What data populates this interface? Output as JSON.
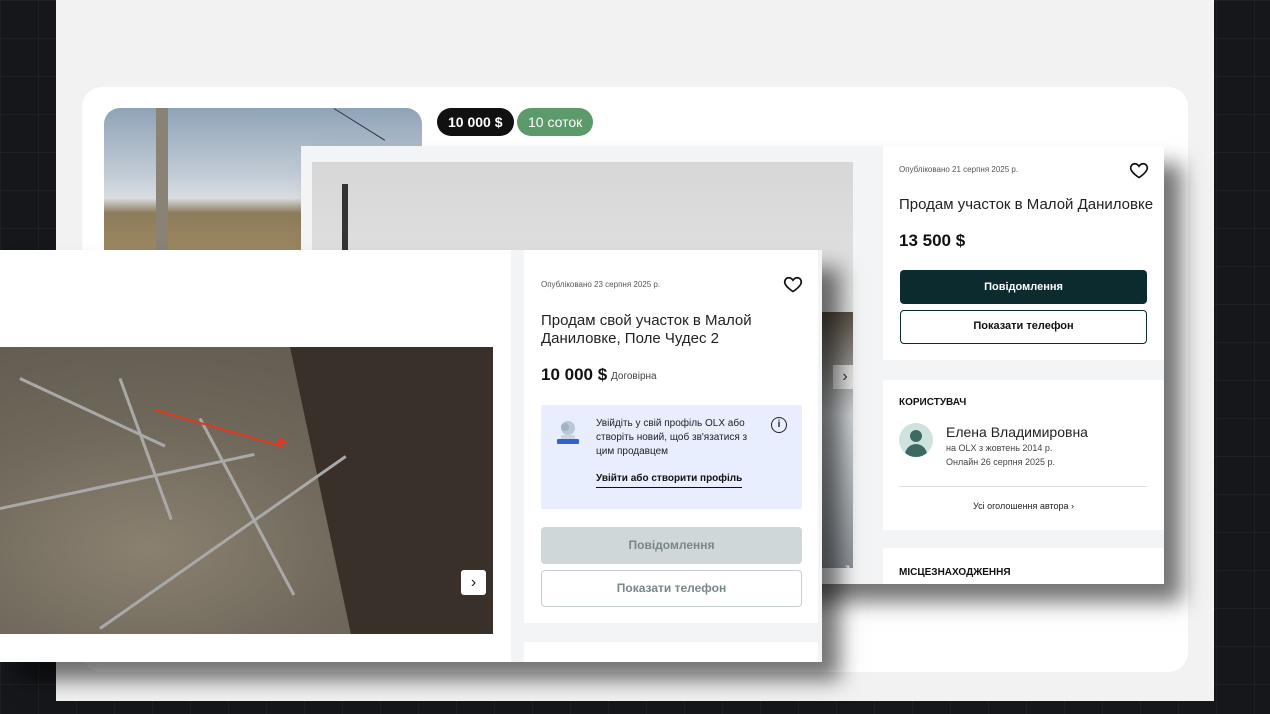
{
  "listing_bg": {
    "price_pill": "10 000 $",
    "area_pill": "10 соток"
  },
  "listing_mid": {
    "published": "Опубліковано 21 серпня 2025 р.",
    "title": "Продам участок в Малой Даниловке",
    "price": "13 500 $",
    "message_button": "Повідомлення",
    "phone_button": "Показати телефон",
    "user": {
      "heading": "КОРИСТУВАЧ",
      "name": "Елена Владимировна",
      "since": "на OLX з жовтень 2014 р.",
      "online": "Онлайн 26 серпня 2025 р.",
      "all_ads": "Усі оголошення автора"
    },
    "location_heading": "МІСЦЕЗНАХОДЖЕННЯ"
  },
  "listing_front": {
    "published": "Опубліковано 23 серпня 2025 р.",
    "title": "Продам свой участок в Малой Даниловке, Поле Чудес 2",
    "price": "10 000 $",
    "negotiable": "Договірна",
    "login_prompt": "Увійдіть у свій профіль OLX або створіть новий, щоб зв'язатися з цим продавцем",
    "login_link": "Увійти або створити профіль",
    "message_button": "Повідомлення",
    "phone_button": "Показати телефон"
  },
  "icons": {
    "heart": "heart-icon",
    "next": "chevron-right-icon",
    "expand": "expand-icon",
    "info": "info-icon",
    "arrow": "chevron-right-icon"
  },
  "colors": {
    "dark_button": "#0b2b2e",
    "area_pill": "#5c9a6b",
    "login_box": "#e8eefd"
  }
}
